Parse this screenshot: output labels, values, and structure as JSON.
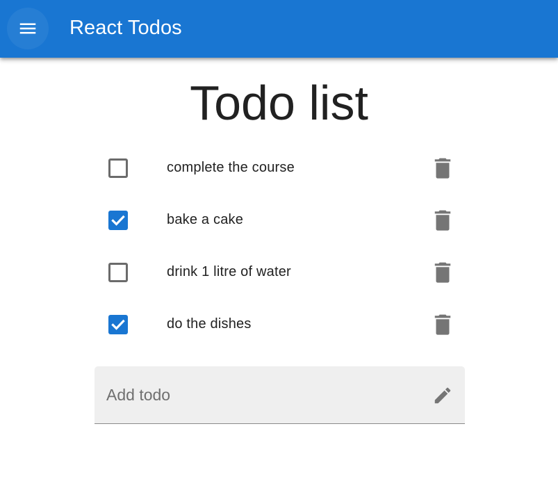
{
  "app_bar": {
    "title": "React Todos",
    "menu_icon": "menu-icon",
    "background_color": "#1976d2"
  },
  "page": {
    "title": "Todo list"
  },
  "todos": [
    {
      "text": "complete the course",
      "checked": false
    },
    {
      "text": "bake a cake",
      "checked": true
    },
    {
      "text": "drink 1 litre of water",
      "checked": false
    },
    {
      "text": "do the dishes",
      "checked": true
    }
  ],
  "add_todo": {
    "placeholder": "Add todo",
    "value": "",
    "icon": "pencil-icon"
  },
  "colors": {
    "accent": "#1976d2",
    "icon_gray": "#757575",
    "text": "#212121"
  }
}
